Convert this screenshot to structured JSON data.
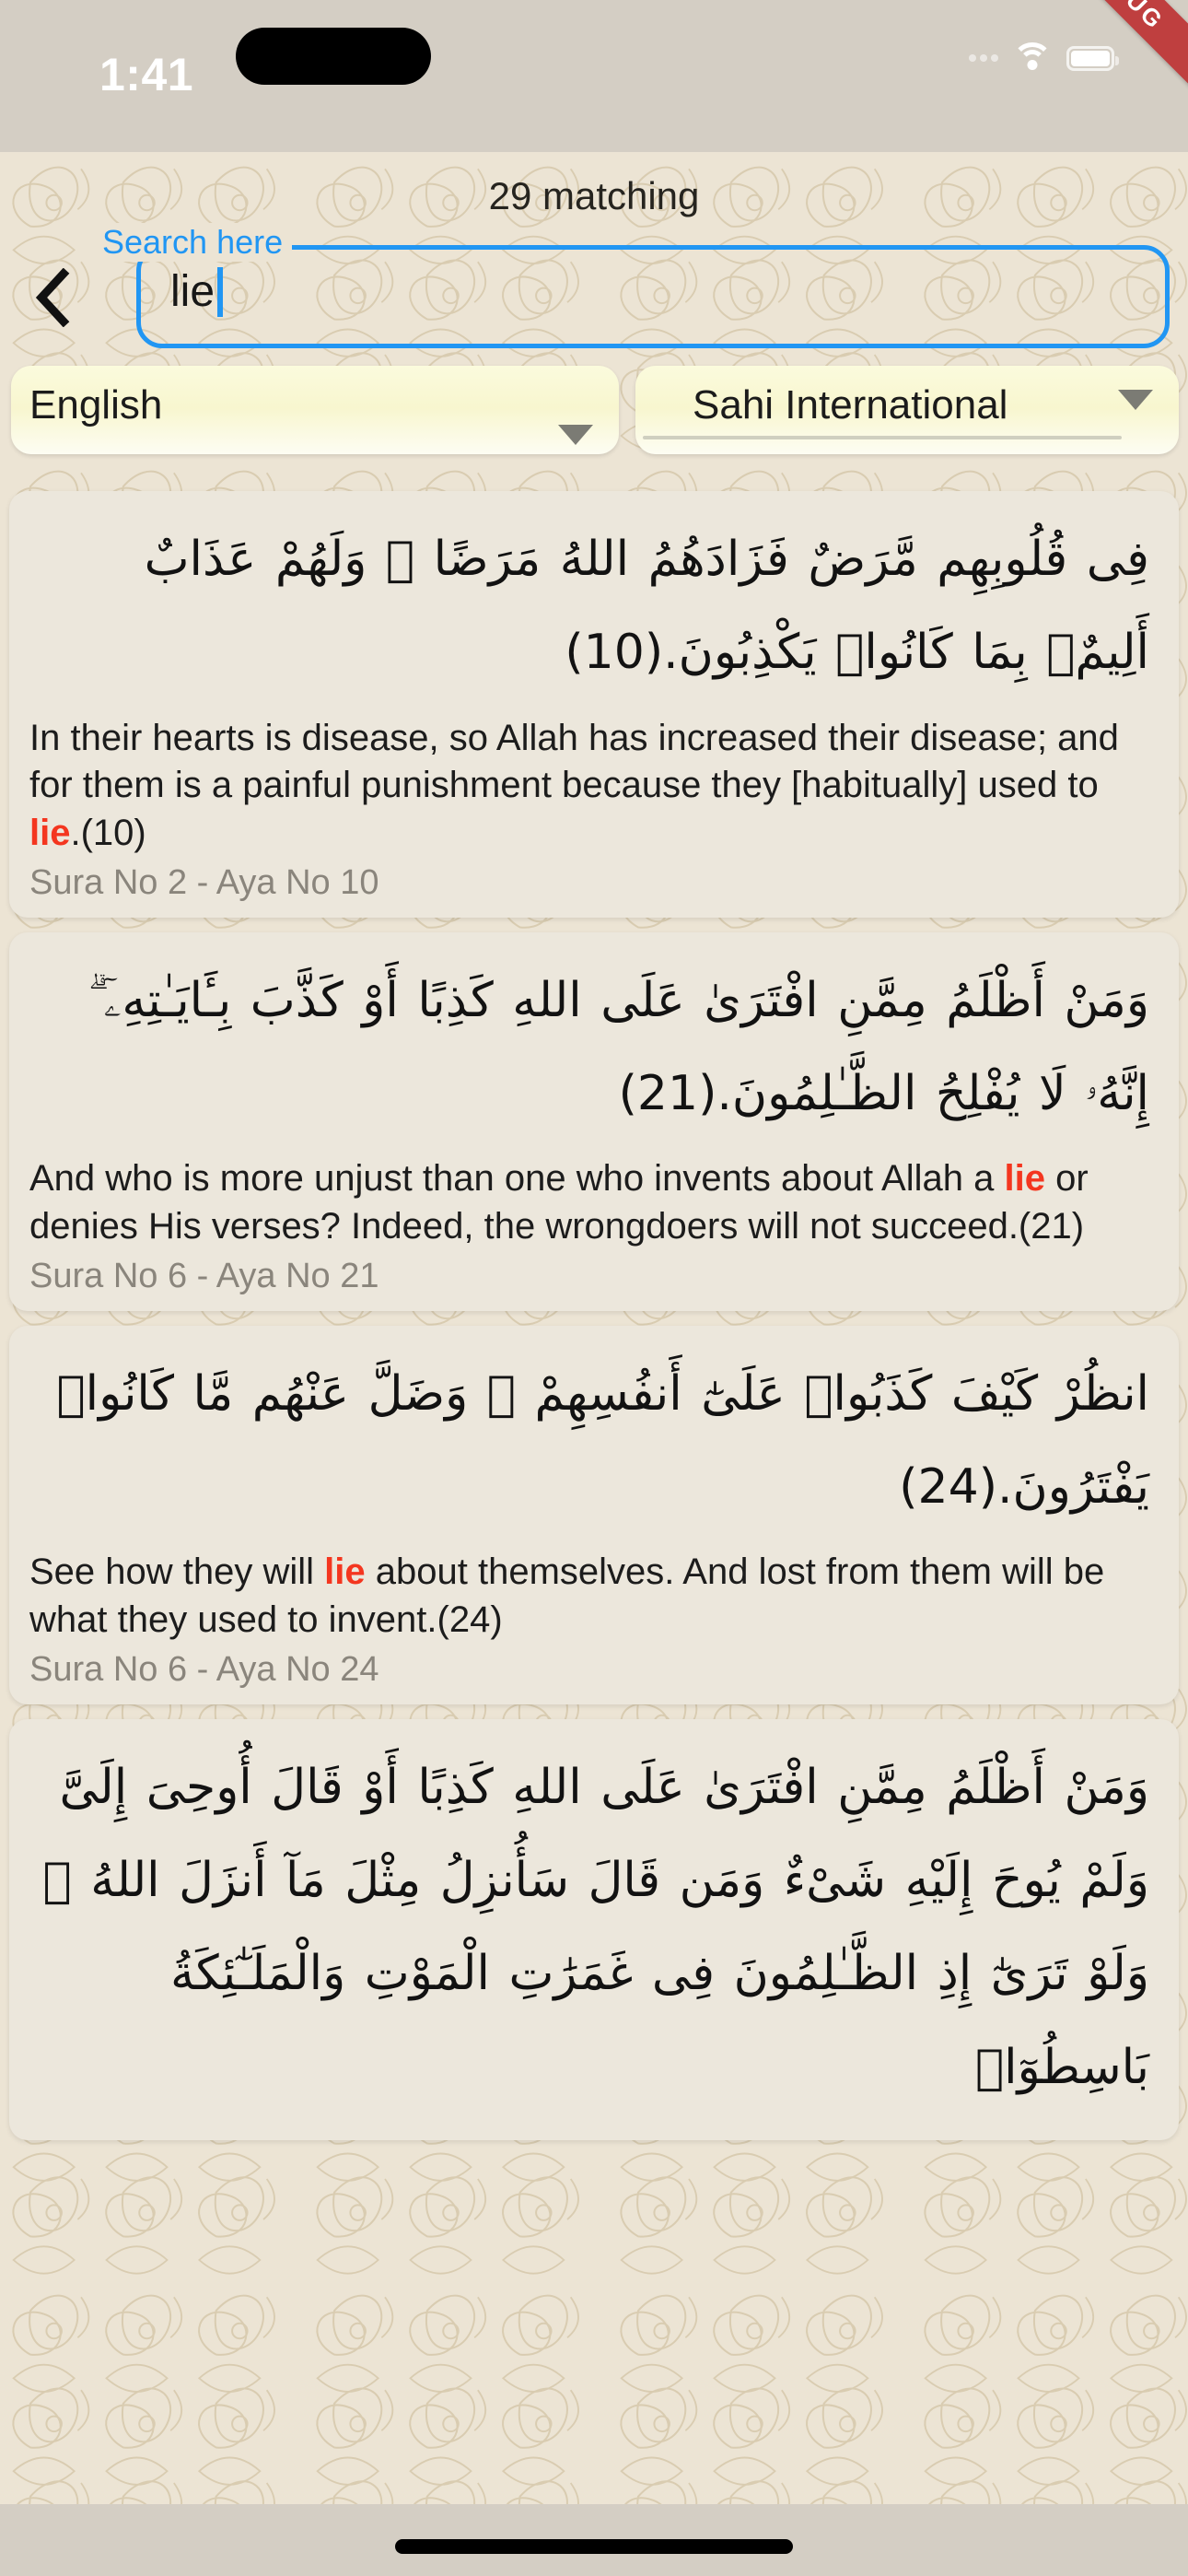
{
  "status_bar": {
    "time": "1:41",
    "wifi_icon": "wifi-icon",
    "battery_icon": "battery-icon",
    "signal_icon": "signal-dots-icon"
  },
  "debug_banner": {
    "label": "DEBUG",
    "color": "#bf3f3f"
  },
  "header": {
    "matching_count_label": "29 matching",
    "back_icon": "chevron-left-icon"
  },
  "search": {
    "floating_label": "Search here",
    "value": "lie",
    "placeholder": "Search here",
    "accent_color": "#2196f3"
  },
  "filters": {
    "language": {
      "value": "English",
      "arrow_icon": "caret-down-icon"
    },
    "translator": {
      "value": "Sahi International",
      "arrow_icon": "caret-down-icon"
    }
  },
  "highlight_color": "#f4361f",
  "results": [
    {
      "arabic": "فِى قُلُوبِهِم مَّرَضٌ فَزَادَهُمُ اللهُ مَرَضًا ۖ وَلَهُمْ عَذَابٌ أَلِيمٌۢ بِمَا كَانُوا۟ يَكْذِبُونَ.(10)",
      "translation_before": "In their hearts is disease, so Allah has increased their disease; and for them is a painful punishment because they [habitually] used to ",
      "translation_highlight": "lie",
      "translation_after": ".(10)",
      "reference": "Sura No 2 - Aya No 10"
    },
    {
      "arabic": "وَمَنْ أَظْلَمُ مِمَّنِ افْتَرَىٰ عَلَى اللهِ كَذِبًا أَوْ كَذَّبَ بِـَٔايَـٰتِهِۦٓ ۗ إِنَّهُۥ لَا يُفْلِحُ الظَّـٰلِمُونَ.(21)",
      "translation_before": "And who is more unjust than one who invents about Allah a ",
      "translation_highlight": "lie",
      "translation_after": " or denies His verses? Indeed, the wrongdoers will not succeed.(21)",
      "reference": "Sura No 6 - Aya No 21"
    },
    {
      "arabic": "انظُرْ كَيْفَ كَذَبُوا۟ عَلَىٰٓ أَنفُسِهِمْ ۚ وَضَلَّ عَنْهُم مَّا كَانُوا۟ يَفْتَرُونَ.(24)",
      "translation_before": "See how they will ",
      "translation_highlight": "lie",
      "translation_after": " about themselves. And lost from them will be what they used to invent.(24)",
      "reference": "Sura No 6 - Aya No 24"
    },
    {
      "arabic": "وَمَنْ أَظْلَمُ مِمَّنِ افْتَرَىٰ عَلَى اللهِ كَذِبًا أَوْ قَالَ أُوحِىَ إِلَىَّ وَلَمْ يُوحَ إِلَيْهِ شَىْءٌ وَمَن قَالَ سَأُنزِلُ مِثْلَ مَآ أَنزَلَ اللهُ ۗ وَلَوْ تَرَىٰٓ إِذِ الظَّـٰلِمُونَ فِى غَمَرَٰتِ الْمَوْتِ وَالْمَلَـٰٓئِكَةُ بَاسِطُوٓا۟",
      "translation_before": "",
      "translation_highlight": "",
      "translation_after": "",
      "reference": ""
    }
  ]
}
